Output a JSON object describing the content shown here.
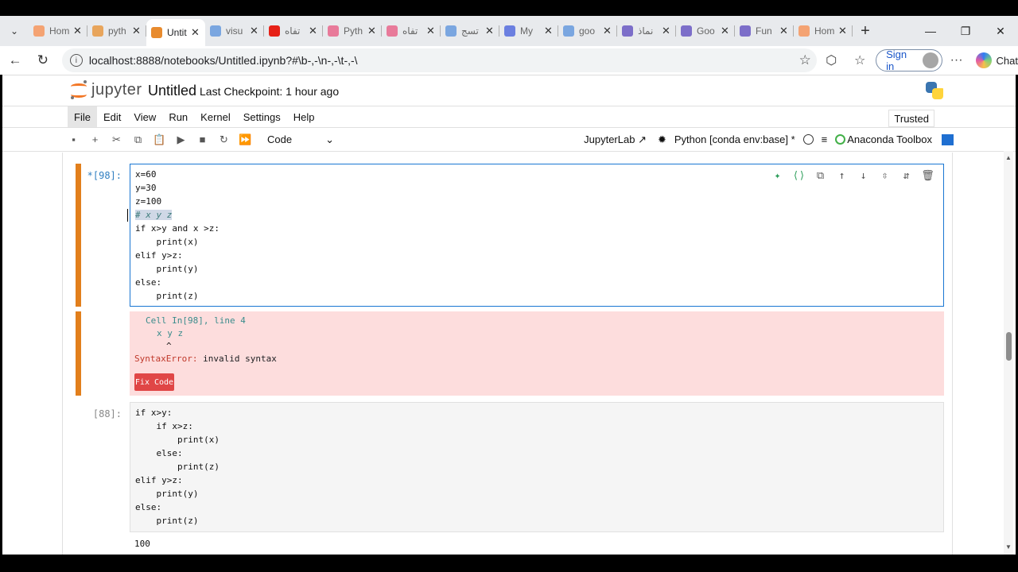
{
  "browser": {
    "tabs": [
      {
        "label": "Hom",
        "color": "#f4a373",
        "active": false
      },
      {
        "label": "pyth",
        "color": "#e8a55c",
        "active": false
      },
      {
        "label": "Untit",
        "color": "#e88b2e",
        "active": true
      },
      {
        "label": "visu",
        "color": "#7aa6e0",
        "active": false
      },
      {
        "label": "تفاه",
        "color": "#e62117",
        "active": false
      },
      {
        "label": "Pyth",
        "color": "#e87a9a",
        "active": false
      },
      {
        "label": "تفاه",
        "color": "#e87a9a",
        "active": false
      },
      {
        "label": "تسج",
        "color": "#7aa6e0",
        "active": false
      },
      {
        "label": "My",
        "color": "#6b7fe0",
        "active": false
      },
      {
        "label": "goo",
        "color": "#7aa6e0",
        "active": false
      },
      {
        "label": "نماذ",
        "color": "#7c6ec9",
        "active": false
      },
      {
        "label": "Goo",
        "color": "#7c6ec9",
        "active": false
      },
      {
        "label": "Fun",
        "color": "#7c6ec9",
        "active": false
      },
      {
        "label": "Hom",
        "color": "#f4a373",
        "active": false
      }
    ],
    "url": "localhost:8888/notebooks/Untitled.ipynb?#\\b-,-\\n-,-\\t-,-\\",
    "sign_in": "Sign in",
    "chat": "Chat"
  },
  "jupyter": {
    "logo_text": "jupyter",
    "title": "Untitled",
    "checkpoint": "Last Checkpoint: 1 hour ago",
    "menu": [
      "File",
      "Edit",
      "View",
      "Run",
      "Kernel",
      "Settings",
      "Help"
    ],
    "trusted": "Trusted",
    "cell_type": "Code",
    "jupyterlab": "JupyterLab",
    "kernel": "Python [conda env:base] *",
    "anaconda": "Anaconda Toolbox"
  },
  "cells": {
    "cell1": {
      "prompt": "*[98]:",
      "lines": [
        "x=60",
        "y=30",
        "z=100",
        "# x y z",
        "if x>y and x >z:",
        "    print(x)",
        "elif y>z:",
        "    print(y)",
        "else:",
        "    print(z)"
      ]
    },
    "error": {
      "line1": "Cell In[98], line 4",
      "line2": "x y z",
      "line3": "^",
      "err_name": "SyntaxError:",
      "err_msg": "invalid syntax",
      "fix_button": "Fix Code"
    },
    "cell2": {
      "prompt": "[88]:",
      "lines": [
        "if x>y:",
        "    if x>z:",
        "        print(x)",
        "    else:",
        "        print(z)",
        "elif y>z:",
        "    print(y)",
        "else:",
        "    print(z)"
      ],
      "output": "100"
    }
  },
  "colors": {
    "accent_orange": "#e27f1c",
    "active_border": "#1976d2",
    "error_bg": "#fddddd",
    "fix_button": "#e04646"
  }
}
